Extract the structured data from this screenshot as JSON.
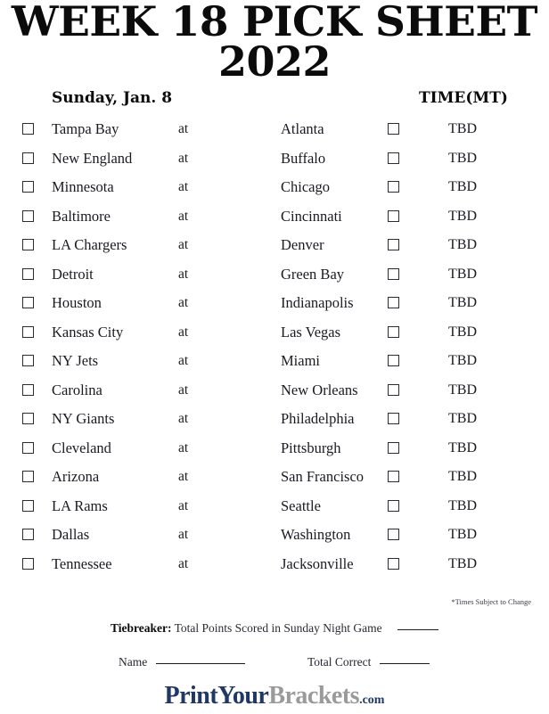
{
  "title": {
    "line1": "WEEK 18 PICK SHEET",
    "line2": "2022"
  },
  "headers": {
    "day": "Sunday, Jan. 8",
    "time": "TIME(MT)"
  },
  "labels": {
    "at": "at",
    "tbd": "TBD"
  },
  "games": [
    {
      "home": "Tampa Bay",
      "at": "at",
      "away": "Atlanta",
      "time": "TBD"
    },
    {
      "home": "New England",
      "at": "at",
      "away": "Buffalo",
      "time": "TBD"
    },
    {
      "home": "Minnesota",
      "at": "at",
      "away": "Chicago",
      "time": "TBD"
    },
    {
      "home": "Baltimore",
      "at": "at",
      "away": "Cincinnati",
      "time": "TBD"
    },
    {
      "home": "LA Chargers",
      "at": "at",
      "away": "Denver",
      "time": "TBD"
    },
    {
      "home": "Detroit",
      "at": "at",
      "away": "Green Bay",
      "time": "TBD"
    },
    {
      "home": "Houston",
      "at": "at",
      "away": "Indianapolis",
      "time": "TBD"
    },
    {
      "home": "Kansas City",
      "at": "at",
      "away": "Las Vegas",
      "time": "TBD"
    },
    {
      "home": "NY Jets",
      "at": "at",
      "away": "Miami",
      "time": "TBD"
    },
    {
      "home": "Carolina",
      "at": "at",
      "away": "New Orleans",
      "time": "TBD"
    },
    {
      "home": "NY Giants",
      "at": "at",
      "away": "Philadelphia",
      "time": "TBD"
    },
    {
      "home": "Cleveland",
      "at": "at",
      "away": "Pittsburgh",
      "time": "TBD"
    },
    {
      "home": "Arizona",
      "at": "at",
      "away": "San Francisco",
      "time": "TBD"
    },
    {
      "home": "LA Rams",
      "at": "at",
      "away": "Seattle",
      "time": "TBD"
    },
    {
      "home": "Dallas",
      "at": "at",
      "away": "Washington",
      "time": "TBD"
    },
    {
      "home": "Tennessee",
      "at": "at",
      "away": "Jacksonville",
      "time": "TBD"
    }
  ],
  "footnote": "*Times Subject to Change",
  "tiebreaker": {
    "label": "Tiebreaker:",
    "text": "Total Points Scored in Sunday Night Game"
  },
  "footer": {
    "name_label": "Name",
    "total_correct_label": "Total Correct"
  },
  "logo": {
    "part1": "PrintYour",
    "part2": "Brackets",
    "part3": ".com"
  },
  "colors": {
    "title": "#0b0b0b",
    "text": "#1a1a22",
    "checkbox_border": "#2b2b33",
    "logo_navy": "#1f3864",
    "logo_gray": "#9a9a9a",
    "background": "#ffffff"
  }
}
